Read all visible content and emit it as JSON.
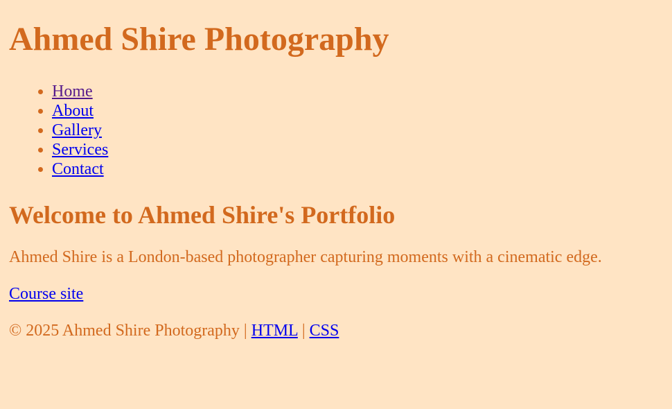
{
  "header": {
    "title": "Ahmed Shire Photography"
  },
  "nav": {
    "items": [
      {
        "label": "Home"
      },
      {
        "label": "About"
      },
      {
        "label": "Gallery"
      },
      {
        "label": "Services"
      },
      {
        "label": "Contact"
      }
    ]
  },
  "main": {
    "heading": "Welcome to Ahmed Shire's Portfolio",
    "intro": "Ahmed Shire is a London-based photographer capturing moments with a cinematic edge.",
    "course_link": "Course site"
  },
  "footer": {
    "copyright": "© 2025 Ahmed Shire Photography",
    "sep1": " | ",
    "html_link": "HTML",
    "sep2": " | ",
    "css_link": "CSS"
  },
  "colors": {
    "background": "#ffe4c4",
    "text": "#d2691e",
    "link": "#0000ee",
    "visited_link": "#551a8b"
  }
}
